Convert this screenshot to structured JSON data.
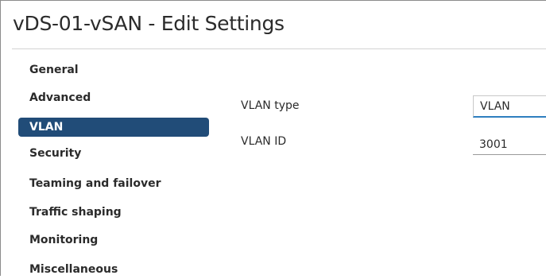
{
  "dialog": {
    "title": "vDS-01-vSAN - Edit Settings"
  },
  "nav": {
    "items": [
      {
        "label": "General",
        "active": false
      },
      {
        "label": "Advanced",
        "active": false
      },
      {
        "label": "VLAN",
        "active": true
      },
      {
        "label": "Security",
        "active": false
      },
      {
        "label": "Teaming and failover",
        "active": false
      },
      {
        "label": "Traffic shaping",
        "active": false
      },
      {
        "label": "Monitoring",
        "active": false
      },
      {
        "label": "Miscellaneous",
        "active": false
      }
    ]
  },
  "form": {
    "vlan_type": {
      "label": "VLAN type",
      "value": "VLAN"
    },
    "vlan_id": {
      "label": "VLAN ID",
      "value": "3001"
    }
  },
  "colors": {
    "active_nav_bg": "#214c78",
    "focus_underline": "#2f7fbf"
  }
}
